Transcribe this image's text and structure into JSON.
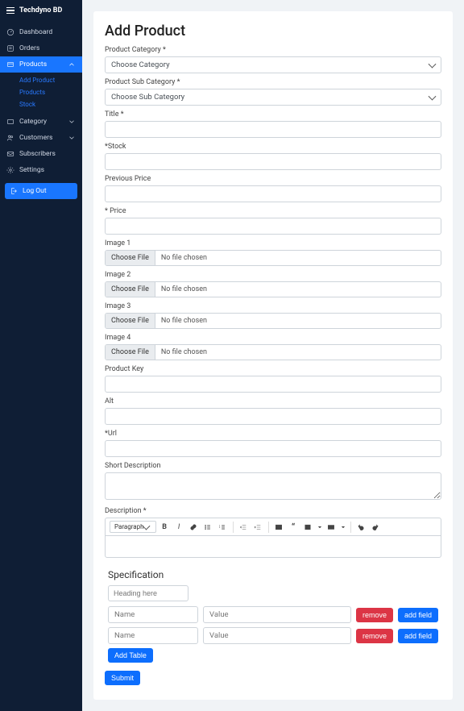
{
  "brand": "Techdyno BD",
  "sidebar": {
    "dashboard": "Dashboard",
    "orders": "Orders",
    "products": "Products",
    "sub_add": "Add Product",
    "sub_list": "Products",
    "sub_stock": "Stock",
    "category": "Category",
    "customers": "Customers",
    "subscribers": "Subscribers",
    "settings": "Settings",
    "logout": "Log Out"
  },
  "page": {
    "title": "Add Product",
    "labels": {
      "category": "Product Category *",
      "subcategory": "Product Sub Category *",
      "titleField": "Title *",
      "stock": "*Stock",
      "prevPrice": "Previous Price",
      "price": "* Price",
      "img1": "Image 1",
      "img2": "Image 2",
      "img3": "Image 3",
      "img4": "Image 4",
      "productKey": "Product Key",
      "alt": "Alt",
      "url": "*Url",
      "shortDesc": "Short Description",
      "desc": "Description *"
    },
    "selects": {
      "categoryPlaceholder": "Choose Category",
      "subcategoryPlaceholder": "Choose Sub Category"
    },
    "file": {
      "button": "Choose File",
      "none": "No file chosen"
    },
    "editor": {
      "formatSel": "Paragraph"
    },
    "spec": {
      "title": "Specification",
      "headingPh": "Heading here",
      "namePh": "Name",
      "valuePh": "Value",
      "remove": "remove",
      "addField": "add field",
      "addTable": "Add Table"
    },
    "submit": "Submit"
  }
}
